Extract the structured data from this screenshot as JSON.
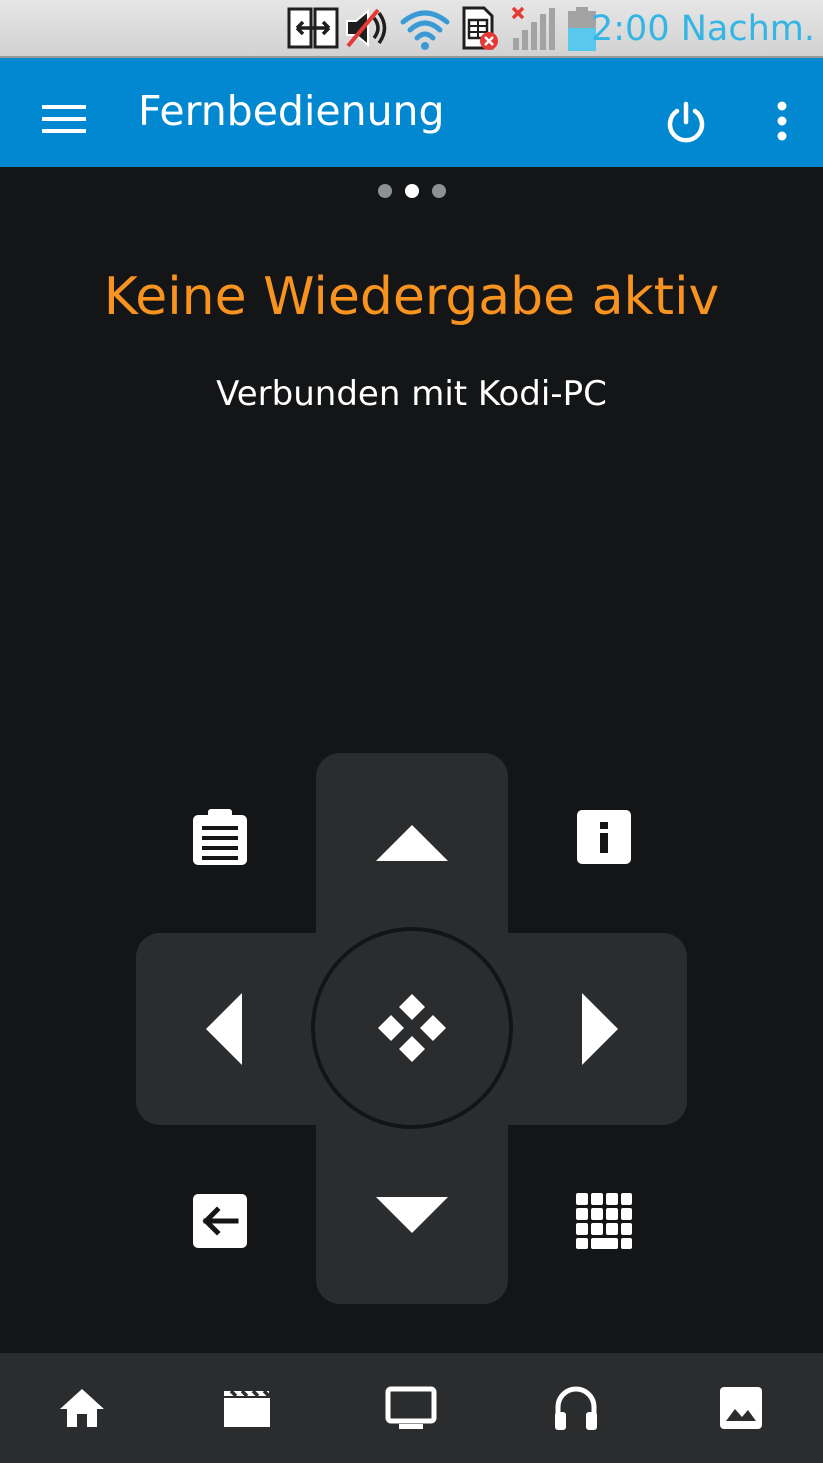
{
  "status_bar": {
    "time": "2:00 Nachm.",
    "icons": [
      "screen-mirror-icon",
      "volume-muted-icon",
      "wifi-icon",
      "sim-error-icon",
      "signal-none-icon",
      "battery-icon"
    ],
    "time_color": "#33b5e5"
  },
  "app_bar": {
    "title": "Fernbedienung",
    "icons": [
      "menu-icon",
      "power-icon",
      "more-vert-icon"
    ],
    "background": "#0288d1"
  },
  "pager": {
    "count": 3,
    "active_index": 1
  },
  "playback": {
    "headline": "Keine Wiedergabe aktiv",
    "headline_color": "#f7931e",
    "connection": "Verbunden mit Kodi-PC"
  },
  "remote": {
    "buttons": [
      "clipboard-icon",
      "arrow-up-icon",
      "info-icon",
      "arrow-left-icon",
      "kodi-select-icon",
      "arrow-right-icon",
      "back-icon",
      "arrow-down-icon",
      "keypad-icon"
    ]
  },
  "bottom_nav": {
    "items": [
      "home-icon",
      "movies-icon",
      "tv-icon",
      "music-icon",
      "pictures-icon"
    ]
  }
}
